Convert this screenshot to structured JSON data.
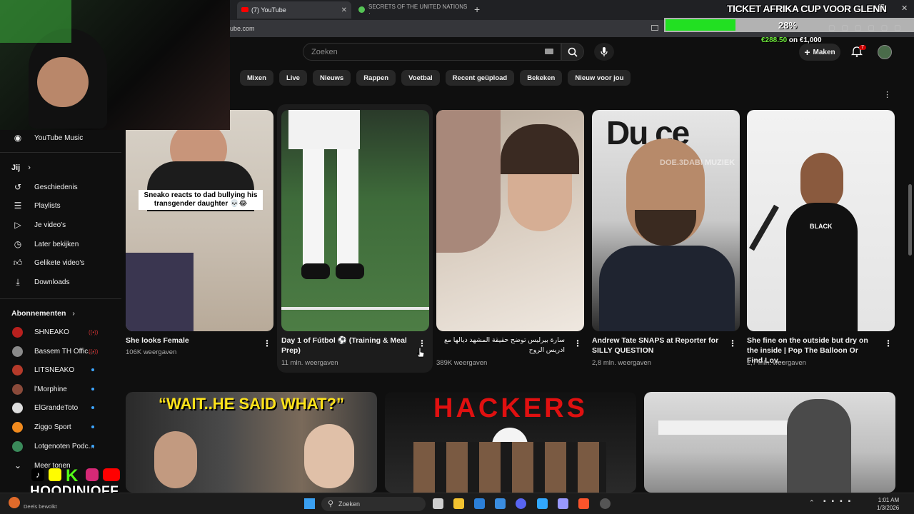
{
  "browser": {
    "tabs": [
      {
        "title": "(7) YouTube",
        "active": true
      },
      {
        "title": "SECRETS OF THE UNITED NATIONS ·",
        "active": false
      }
    ],
    "url": "ube.com"
  },
  "header": {
    "search_placeholder": "Zoeken",
    "make_label": "Maken",
    "notif_count": "7"
  },
  "chips": [
    "Mixen",
    "Live",
    "Nieuws",
    "Rappen",
    "Voetbal",
    "Recent geüpload",
    "Bekeken",
    "Nieuw voor jou"
  ],
  "sidebar": {
    "top_item": "YouTube Music",
    "you_heading": "Jij",
    "you_items": [
      "Geschiedenis",
      "Playlists",
      "Je video's",
      "Later bekijken",
      "Gelikete video's",
      "Downloads"
    ],
    "subs_heading": "Abonnementen",
    "subs": [
      {
        "name": "SHNEAKO",
        "status": "live"
      },
      {
        "name": "Bassem TH Offic...",
        "status": "live"
      },
      {
        "name": "LITSNEAKO",
        "status": "new"
      },
      {
        "name": "l'Morphine",
        "status": "new"
      },
      {
        "name": "ElGrandeToto",
        "status": "new"
      },
      {
        "name": "Ziggo Sport",
        "status": "new"
      },
      {
        "name": "Lotgenoten Podc...",
        "status": "new"
      }
    ],
    "more": "Meer tonen"
  },
  "videos": [
    {
      "title": "She looks Female",
      "meta": "106K weergaven",
      "caption": "Sneako reacts to dad bullying his transgender daughter 💀😂"
    },
    {
      "title": "Day 1 of Fútbol ⚽ (Training & Meal Prep)",
      "meta": "11 mln. weergaven"
    },
    {
      "title": "سارة بيرليس توضح حقيقة المشهد ديالها مع ادريس الروح",
      "meta": "389K weergaven"
    },
    {
      "title": "Andrew Tate SNAPS at Reporter for SILLY QUESTION",
      "meta": "2,8 mln. weergaven",
      "watermark": "DOE.3DABI MUZIEK"
    },
    {
      "title": "She fine on the outside but dry on the inside | Pop The Balloon Or Find Lov...",
      "meta": "2,7 mln. weergaven",
      "overlay": "BLACK"
    }
  ],
  "row2": [
    {
      "overlay": "“WAIT..HE SAID WHAT?”"
    },
    {
      "overlay": "HACKERS"
    },
    {
      "overlay": ""
    }
  ],
  "stream": {
    "goal_title": "TICKET AFRIKA CUP VOOR GLENN",
    "goal_percent": "28%",
    "goal_progress": 0.28,
    "goal_amount": "€288.50",
    "goal_target": " on €1,000",
    "streamer": "HOODINIOFF"
  },
  "taskbar": {
    "search": "Zoeken",
    "time": "1:01 AM",
    "date": "1/3/2026",
    "weather": "Deels bewolkt"
  },
  "colors": {
    "accent_red": "#ff0000",
    "goal_green": "#22e022",
    "bg": "#0f0f0f"
  }
}
